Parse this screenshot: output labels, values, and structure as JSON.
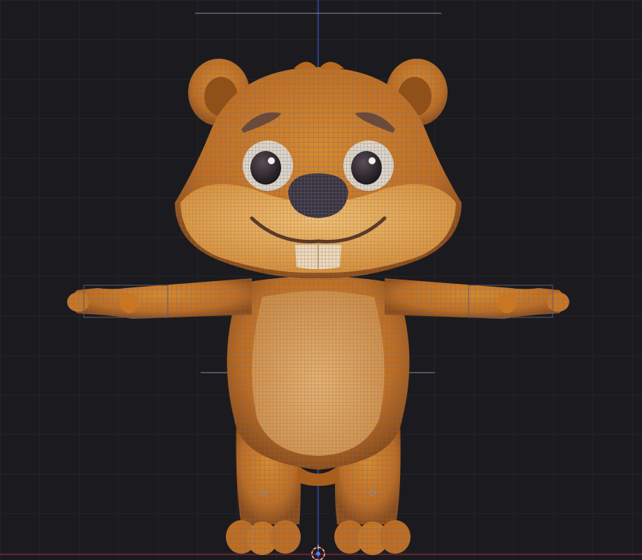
{
  "viewport": {
    "view": "front",
    "shading": "solid-wireframe-overlay",
    "background_color": "#1b1b1f",
    "grid_color": "#2c2c33",
    "grid_color_major": "#34343c",
    "x_axis_color": "#7a2636",
    "z_axis_color": "#3f5bd0"
  },
  "object": {
    "name": "beaver-character",
    "pose": "T-pose",
    "fur_color": "#c9741f",
    "belly_color": "#e0a15a",
    "muzzle_color": "#f0b05a",
    "nose_color": "#3a3440",
    "wire_color": "#7c7a8c",
    "tooth_color": "#efd9b8"
  },
  "cursor_3d": {
    "icon": "3d-cursor-icon"
  }
}
